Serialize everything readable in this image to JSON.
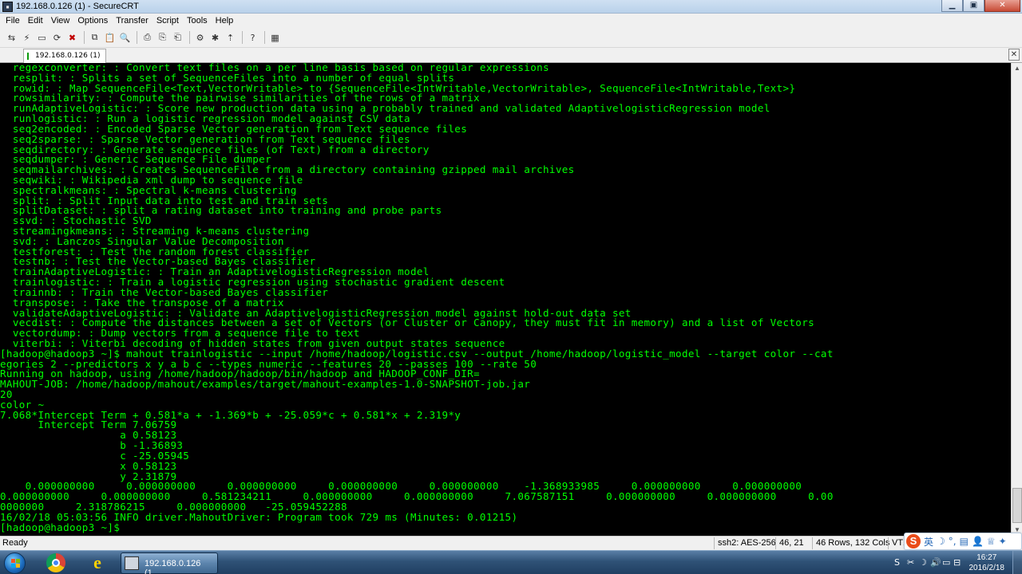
{
  "window": {
    "title": "192.168.0.126 (1) - SecureCRT",
    "minimize_glyph": "▁",
    "maximize_glyph": "▣",
    "close_glyph": "✕"
  },
  "menu": [
    "File",
    "Edit",
    "View",
    "Options",
    "Transfer",
    "Script",
    "Tools",
    "Help"
  ],
  "toolbar": {
    "icons": [
      "connect-icon",
      "quick-connect-icon",
      "connect-in-tab-icon",
      "reconnect-icon",
      "disconnect-icon",
      "copy-icon",
      "paste-icon",
      "find-icon",
      "print-icon",
      "print-setup-icon",
      "print-selection-icon",
      "session-options-icon",
      "global-options-icon",
      "sftp-icon",
      "help-icon",
      "keymap-icon"
    ],
    "glyphs": [
      "⇆",
      "⚡",
      "▭",
      "⟳",
      "✖",
      "⧉",
      "📋",
      "🔍",
      "⎙",
      "⎘",
      "⎗",
      "⚙",
      "✱",
      "⇡",
      "?",
      "▦"
    ]
  },
  "tab": {
    "label": "192.168.0.126  (1)",
    "close_glyph": "✕"
  },
  "terminal": {
    "lines": [
      "  regexconverter: : Convert text files on a per line basis based on regular expressions",
      "  resplit: : Splits a set of SequenceFiles into a number of equal splits",
      "  rowid: : Map SequenceFile<Text,VectorWritable> to {SequenceFile<IntWritable,VectorWritable>, SequenceFile<IntWritable,Text>}",
      "  rowsimilarity: : Compute the pairwise similarities of the rows of a matrix",
      "  runAdaptiveLogistic: : Score new production data using a probably trained and validated AdaptivelogisticRegression model",
      "  runlogistic: : Run a logistic regression model against CSV data",
      "  seq2encoded: : Encoded Sparse Vector generation from Text sequence files",
      "  seq2sparse: : Sparse Vector generation from Text sequence files",
      "  seqdirectory: : Generate sequence files (of Text) from a directory",
      "  seqdumper: : Generic Sequence File dumper",
      "  seqmailarchives: : Creates SequenceFile from a directory containing gzipped mail archives",
      "  seqwiki: : Wikipedia xml dump to sequence file",
      "  spectralkmeans: : Spectral k-means clustering",
      "  split: : Split Input data into test and train sets",
      "  splitDataset: : split a rating dataset into training and probe parts",
      "  ssvd: : Stochastic SVD",
      "  streamingkmeans: : Streaming k-means clustering",
      "  svd: : Lanczos Singular Value Decomposition",
      "  testforest: : Test the random forest classifier",
      "  testnb: : Test the Vector-based Bayes classifier",
      "  trainAdaptiveLogistic: : Train an AdaptivelogisticRegression model",
      "  trainlogistic: : Train a logistic regression using stochastic gradient descent",
      "  trainnb: : Train the Vector-based Bayes classifier",
      "  transpose: : Take the transpose of a matrix",
      "  validateAdaptiveLogistic: : Validate an AdaptivelogisticRegression model against hold-out data set",
      "  vecdist: : Compute the distances between a set of Vectors (or Cluster or Canopy, they must fit in memory) and a list of Vectors",
      "  vectordump: : Dump vectors from a sequence file to text",
      "  viterbi: : Viterbi decoding of hidden states from given output states sequence",
      "[hadoop@hadoop3 ~]$ mahout trainlogistic --input /home/hadoop/logistic.csv --output /home/hadoop/logistic_model --target color --cat",
      "egories 2 --predictors x y a b c --types numeric --features 20 --passes 100 --rate 50",
      "Running on hadoop, using /home/hadoop/hadoop/bin/hadoop and HADOOP_CONF_DIR=",
      "MAHOUT-JOB: /home/hadoop/mahout/examples/target/mahout-examples-1.0-SNAPSHOT-job.jar",
      "20",
      "color ~",
      "7.068*Intercept Term + 0.581*a + -1.369*b + -25.059*c + 0.581*x + 2.319*y",
      "      Intercept Term 7.06759",
      "                   a 0.58123",
      "                   b -1.36893",
      "                   c -25.05945",
      "                   x 0.58123",
      "                   y 2.31879",
      "    0.000000000     0.000000000     0.000000000     0.000000000     0.000000000    -1.368933985     0.000000000     0.000000000",
      "0.000000000     0.000000000     0.581234211     0.000000000     0.000000000     7.067587151     0.000000000     0.000000000     0.00",
      "0000000     2.318786215     0.000000000   -25.059452288",
      "16/02/18 05:03:56 INFO driver.MahoutDriver: Program took 729 ms (Minutes: 0.01215)",
      "[hadoop@hadoop3 ~]$ "
    ]
  },
  "statusbar": {
    "ready": "Ready",
    "cipher": "ssh2: AES-256",
    "cursor": "46,  21",
    "size": "46 Rows, 132 Cols",
    "emulation": "VT1"
  },
  "ime": {
    "logo": "S",
    "lang": "英",
    "moon": "☽",
    "punct": "°,",
    "keyboard": "▤",
    "user": "👤",
    "shirt": "♕",
    "tools": "✦"
  },
  "taskbar": {
    "task_label": "192.168.0.126 (1...",
    "ie_glyph": "e",
    "tray_glyphs": [
      "S",
      "✂",
      "☽",
      "🔊",
      "▭",
      "⊟"
    ],
    "clock_time": "16:27",
    "clock_date": "2016/2/18"
  },
  "colors": {
    "terminal_fg": "#00ff00",
    "terminal_bg": "#000000",
    "chrome": "#f0f0f0",
    "taskbar": "#2f5277"
  }
}
